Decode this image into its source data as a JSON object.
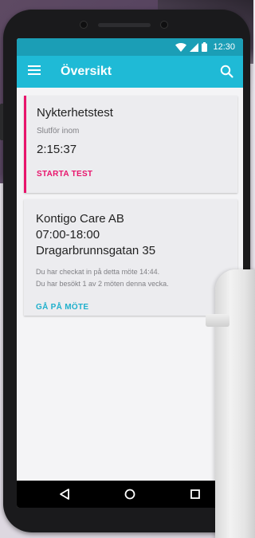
{
  "status_bar": {
    "time": "12:30"
  },
  "app_bar": {
    "title": "Översikt",
    "menu_icon": "menu-icon",
    "search_icon": "search-icon"
  },
  "cards": [
    {
      "title": "Nykterhetstest",
      "subtitle": "Slutför inom",
      "timer": "2:15:37",
      "action": "STARTA TEST",
      "accent_color": "#e8146c"
    },
    {
      "lines": [
        "Kontigo Care AB",
        "07:00-18:00",
        "Dragarbrunnsgatan 35"
      ],
      "info": [
        "Du har checkat in på detta möte 14:44.",
        "Du har besökt 1 av 2 möten denna vecka."
      ],
      "action": "GÅ PÅ MÖTE",
      "accent_color": "#1fb0cc"
    }
  ],
  "nav": [
    "back-icon",
    "home-icon",
    "recents-icon"
  ],
  "colors": {
    "app_bar": "#1fbad6",
    "status_bar": "#1b9eb6"
  }
}
